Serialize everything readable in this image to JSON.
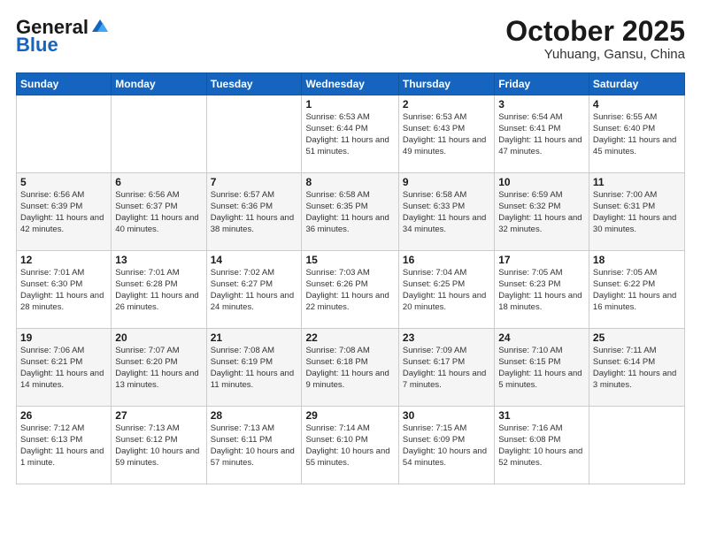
{
  "header": {
    "logo_line1": "General",
    "logo_line2": "Blue",
    "title": "October 2025",
    "subtitle": "Yuhuang, Gansu, China"
  },
  "weekdays": [
    "Sunday",
    "Monday",
    "Tuesday",
    "Wednesday",
    "Thursday",
    "Friday",
    "Saturday"
  ],
  "weeks": [
    [
      {
        "day": "",
        "info": ""
      },
      {
        "day": "",
        "info": ""
      },
      {
        "day": "",
        "info": ""
      },
      {
        "day": "1",
        "info": "Sunrise: 6:53 AM\nSunset: 6:44 PM\nDaylight: 11 hours\nand 51 minutes."
      },
      {
        "day": "2",
        "info": "Sunrise: 6:53 AM\nSunset: 6:43 PM\nDaylight: 11 hours\nand 49 minutes."
      },
      {
        "day": "3",
        "info": "Sunrise: 6:54 AM\nSunset: 6:41 PM\nDaylight: 11 hours\nand 47 minutes."
      },
      {
        "day": "4",
        "info": "Sunrise: 6:55 AM\nSunset: 6:40 PM\nDaylight: 11 hours\nand 45 minutes."
      }
    ],
    [
      {
        "day": "5",
        "info": "Sunrise: 6:56 AM\nSunset: 6:39 PM\nDaylight: 11 hours\nand 42 minutes."
      },
      {
        "day": "6",
        "info": "Sunrise: 6:56 AM\nSunset: 6:37 PM\nDaylight: 11 hours\nand 40 minutes."
      },
      {
        "day": "7",
        "info": "Sunrise: 6:57 AM\nSunset: 6:36 PM\nDaylight: 11 hours\nand 38 minutes."
      },
      {
        "day": "8",
        "info": "Sunrise: 6:58 AM\nSunset: 6:35 PM\nDaylight: 11 hours\nand 36 minutes."
      },
      {
        "day": "9",
        "info": "Sunrise: 6:58 AM\nSunset: 6:33 PM\nDaylight: 11 hours\nand 34 minutes."
      },
      {
        "day": "10",
        "info": "Sunrise: 6:59 AM\nSunset: 6:32 PM\nDaylight: 11 hours\nand 32 minutes."
      },
      {
        "day": "11",
        "info": "Sunrise: 7:00 AM\nSunset: 6:31 PM\nDaylight: 11 hours\nand 30 minutes."
      }
    ],
    [
      {
        "day": "12",
        "info": "Sunrise: 7:01 AM\nSunset: 6:30 PM\nDaylight: 11 hours\nand 28 minutes."
      },
      {
        "day": "13",
        "info": "Sunrise: 7:01 AM\nSunset: 6:28 PM\nDaylight: 11 hours\nand 26 minutes."
      },
      {
        "day": "14",
        "info": "Sunrise: 7:02 AM\nSunset: 6:27 PM\nDaylight: 11 hours\nand 24 minutes."
      },
      {
        "day": "15",
        "info": "Sunrise: 7:03 AM\nSunset: 6:26 PM\nDaylight: 11 hours\nand 22 minutes."
      },
      {
        "day": "16",
        "info": "Sunrise: 7:04 AM\nSunset: 6:25 PM\nDaylight: 11 hours\nand 20 minutes."
      },
      {
        "day": "17",
        "info": "Sunrise: 7:05 AM\nSunset: 6:23 PM\nDaylight: 11 hours\nand 18 minutes."
      },
      {
        "day": "18",
        "info": "Sunrise: 7:05 AM\nSunset: 6:22 PM\nDaylight: 11 hours\nand 16 minutes."
      }
    ],
    [
      {
        "day": "19",
        "info": "Sunrise: 7:06 AM\nSunset: 6:21 PM\nDaylight: 11 hours\nand 14 minutes."
      },
      {
        "day": "20",
        "info": "Sunrise: 7:07 AM\nSunset: 6:20 PM\nDaylight: 11 hours\nand 13 minutes."
      },
      {
        "day": "21",
        "info": "Sunrise: 7:08 AM\nSunset: 6:19 PM\nDaylight: 11 hours\nand 11 minutes."
      },
      {
        "day": "22",
        "info": "Sunrise: 7:08 AM\nSunset: 6:18 PM\nDaylight: 11 hours\nand 9 minutes."
      },
      {
        "day": "23",
        "info": "Sunrise: 7:09 AM\nSunset: 6:17 PM\nDaylight: 11 hours\nand 7 minutes."
      },
      {
        "day": "24",
        "info": "Sunrise: 7:10 AM\nSunset: 6:15 PM\nDaylight: 11 hours\nand 5 minutes."
      },
      {
        "day": "25",
        "info": "Sunrise: 7:11 AM\nSunset: 6:14 PM\nDaylight: 11 hours\nand 3 minutes."
      }
    ],
    [
      {
        "day": "26",
        "info": "Sunrise: 7:12 AM\nSunset: 6:13 PM\nDaylight: 11 hours\nand 1 minute."
      },
      {
        "day": "27",
        "info": "Sunrise: 7:13 AM\nSunset: 6:12 PM\nDaylight: 10 hours\nand 59 minutes."
      },
      {
        "day": "28",
        "info": "Sunrise: 7:13 AM\nSunset: 6:11 PM\nDaylight: 10 hours\nand 57 minutes."
      },
      {
        "day": "29",
        "info": "Sunrise: 7:14 AM\nSunset: 6:10 PM\nDaylight: 10 hours\nand 55 minutes."
      },
      {
        "day": "30",
        "info": "Sunrise: 7:15 AM\nSunset: 6:09 PM\nDaylight: 10 hours\nand 54 minutes."
      },
      {
        "day": "31",
        "info": "Sunrise: 7:16 AM\nSunset: 6:08 PM\nDaylight: 10 hours\nand 52 minutes."
      },
      {
        "day": "",
        "info": ""
      }
    ]
  ]
}
